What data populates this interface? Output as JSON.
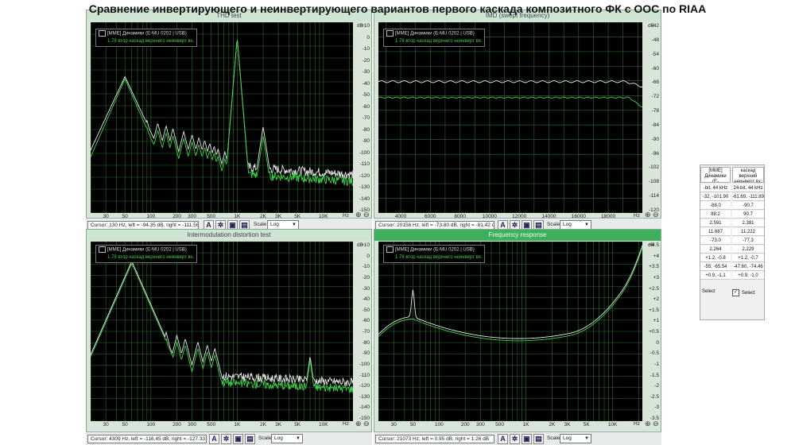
{
  "page_title": "Сравнение инвертирующего и неинвертирующего вариантов первого каскада композитного ФК с ООС по RIAA",
  "legend": {
    "device": "[MME] Динамики (E-MU 0202 | USB)",
    "trace2": "1.78 втор каскад верхнего неинверт вх."
  },
  "colors": {
    "trace_white": "#e6e6e6",
    "trace_green": "#3fd34a",
    "grid": "#2f6b33",
    "bg": "#000000"
  },
  "panels": {
    "thd": {
      "title": "THD test",
      "y_unit": "dB",
      "x_unit": "Hz",
      "y_ticks": [
        "+10",
        "0",
        "-10",
        "-20",
        "-30",
        "-40",
        "-50",
        "-60",
        "-70",
        "-80",
        "-90",
        "-100",
        "-110",
        "-120",
        "-130",
        "-140",
        "-150"
      ],
      "x_ticks": [
        "30",
        "50",
        "100",
        "200",
        "300",
        "500",
        "1K",
        "2K",
        "3K",
        "5K",
        "10K"
      ],
      "cursor": "Cursor:  130 Hz,  left = -94.35 dB,  right = -111.56 dB",
      "scale_label": "Scale",
      "scale_value": "Log"
    },
    "imd_swept": {
      "title": "IMD (swept frequency)",
      "y_unit": "dB",
      "x_unit": "Hz",
      "y_ticks": [
        "-42",
        "-48",
        "-54",
        "-60",
        "-66",
        "-72",
        "-78",
        "-84",
        "-90",
        "-96",
        "-102",
        "-108",
        "-114",
        "-120"
      ],
      "x_ticks": [
        "4000",
        "6000",
        "8000",
        "10000",
        "12000",
        "14000",
        "16000",
        "18000"
      ],
      "cursor": "Cursor:  20156 Hz,  left = -73.80 dB,  right = -81.42 dB",
      "scale_label": "Scale",
      "scale_value": "Log"
    },
    "imd_test": {
      "title": "Intermodulation distortion test",
      "y_unit": "dB",
      "x_unit": "Hz",
      "y_ticks": [
        "+10",
        "0",
        "-10",
        "-20",
        "-30",
        "-40",
        "-50",
        "-60",
        "-70",
        "-80",
        "-90",
        "-100",
        "-110",
        "-120",
        "-130",
        "-140",
        "-150"
      ],
      "x_ticks": [
        "30",
        "50",
        "100",
        "200",
        "300",
        "500",
        "1K",
        "2K",
        "3K",
        "5K",
        "10K"
      ],
      "cursor": "Cursor:  4309 Hz,  left = -116.45 dB,  right = -127.33 dB",
      "scale_label": "Scale",
      "scale_value": "Log"
    },
    "freq_resp": {
      "title": "Frequency response",
      "y_unit": "dB",
      "x_unit": "Hz",
      "y_ticks": [
        "+4.5",
        "+4",
        "+3.5",
        "+3",
        "+2.5",
        "+2",
        "+1.5",
        "+1",
        "+0.5",
        "0",
        "-0.5",
        "-1",
        "-1.5",
        "-2",
        "-2.5",
        "-3",
        "-3.5"
      ],
      "x_ticks": [
        "30",
        "50",
        "100",
        "200",
        "300",
        "500",
        "1K",
        "2K",
        "3K",
        "5K",
        "10K"
      ],
      "cursor": "Cursor:  21073 Hz,  left = 0.95 dB,  right = 1.26 dB",
      "scale_label": "Scale",
      "scale_value": "Log"
    }
  },
  "side_table": {
    "col1_header": "[MME] Динамики (E-",
    "col2_header": "каскад верхний неинверт вх.",
    "rows": [
      [
        "-bit, 44 kHz",
        "24-bit, 44 kHz"
      ],
      [
        "-32, -101.90",
        "-61.69, -111.89"
      ],
      [
        "-88.0",
        "-90.7"
      ],
      [
        "88.2",
        "90.7"
      ],
      [
        "2.591",
        "2.381"
      ],
      [
        "11.687",
        "11.222"
      ],
      [
        "-73.0",
        "-77.3"
      ],
      [
        "2.264",
        "2.229"
      ],
      [
        "+1.2, -0.8",
        "+1.2, -0.7"
      ],
      [
        "-55, -65.54",
        "-47.60, -74.46"
      ],
      [
        "+0.9, -1.1",
        "+0.9, -1.0"
      ]
    ],
    "select_label": "Select"
  }
}
